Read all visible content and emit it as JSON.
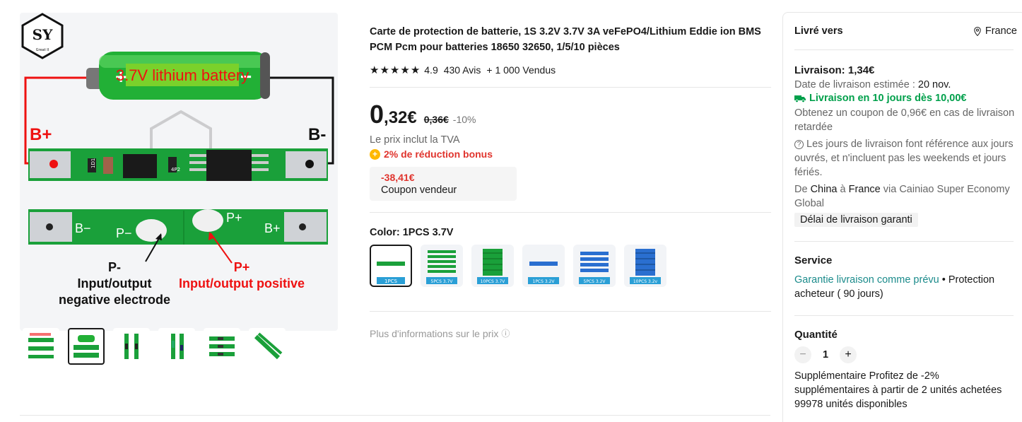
{
  "gallery": {
    "logo_text": "SY",
    "logo_sub": "Great II",
    "battery_label": "3.7V lithium battery",
    "battery_plus": "+",
    "battery_minus": "−",
    "b_plus_label": "B+",
    "b_minus_label": "B-",
    "pcb_chip1": "1D1",
    "pcb_chip2": "4P2",
    "board2_b_minus": "B−",
    "board2_p_minus": "P−",
    "board2_p_plus": "P+",
    "board2_b_plus": "B+",
    "p_minus_title": "P-",
    "p_minus_desc1": "Input/output",
    "p_minus_desc2": "negative electrode",
    "p_plus_title": "P+",
    "p_plus_desc": "Input/output positive",
    "thumbnail_count": 6,
    "active_thumbnail": 2
  },
  "product": {
    "title": "Carte de protection de batterie, 1S 3.2V 3.7V 3A veFePO4/Lithium Eddie ion BMS PCM Pcm pour batteries 18650 32650, 1/5/10 pièces",
    "rating": "4.9",
    "stars": 5,
    "reviews": "430 Avis",
    "sold": "+ 1 000 Vendus",
    "price_int": "0",
    "price_dec": ",32€",
    "price_old": "0,36€",
    "discount": "-10%",
    "tva": "Le prix inclut la TVA",
    "bonus": "2% de réduction bonus",
    "coupon_value": "-38,41€",
    "coupon_label": "Coupon vendeur",
    "color_label": "Color: 1PCS 3.7V",
    "swatches": [
      {
        "label": "1PCS",
        "selected": true
      },
      {
        "label": "5PCS 3.7V",
        "selected": false
      },
      {
        "label": "10PCS 3.7V",
        "selected": false
      },
      {
        "label": "1PCS 3.2V",
        "selected": false
      },
      {
        "label": "5PCS 3.2V",
        "selected": false
      },
      {
        "label": "10PCS 3.2v",
        "selected": false
      }
    ],
    "more_info": "Plus d'informations sur le prix",
    "more_info_icon": "ⓘ"
  },
  "panel": {
    "deliver_to_label": "Livré vers",
    "country": "France",
    "shipping_title": "Livraison: 1,34€",
    "estimate_prefix": "Date de livraison estimée : ",
    "estimate_date": "20 nov.",
    "fast_delivery": "Livraison en 10 jours dès 10,00€",
    "coupon_delay": "Obtenez un coupon de 0,96€ en cas de livraison retardée",
    "working_days_note": "Les jours de livraison font référence aux jours ouvrés, et n'incluent pas les weekends et jours fériés.",
    "route_from_label": "De ",
    "route_from": "China",
    "route_to_label": " à ",
    "route_to": "France",
    "route_via": " via Cainiao Super Economy Global",
    "guaranteed": "Délai de livraison garanti",
    "service_title": "Service",
    "service_link": "Garantie livraison comme prévu",
    "service_rest": " • Protection acheteur ( 90 jours)",
    "qty_title": "Quantité",
    "qty_minus": "−",
    "qty_value": "1",
    "qty_plus": "+",
    "qty_note1": "Supplémentaire Profitez de -2% supplémentaires à partir de 2 unités achetées",
    "qty_note2": "99978 unités disponibles"
  },
  "colors": {
    "accent_red": "#e0342d",
    "green": "#00a04b",
    "teal_link": "#1b8b8b",
    "pcb_green": "#1aa03a"
  }
}
